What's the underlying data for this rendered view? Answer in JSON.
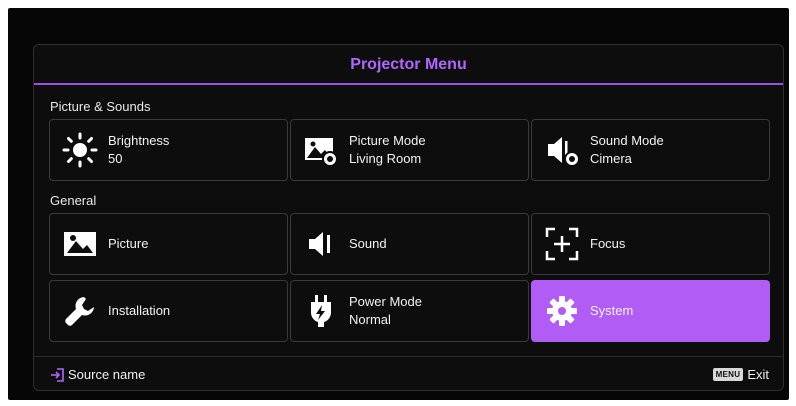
{
  "menu": {
    "title": "Projector Menu",
    "accent_color": "#b05cf5"
  },
  "sections": {
    "picture_sounds": {
      "label": "Picture & Sounds",
      "tiles": [
        {
          "name": "Brightness",
          "value": "50",
          "icon": "sun-icon"
        },
        {
          "name": "Picture Mode",
          "value": "Living Room",
          "icon": "picture-mode-icon"
        },
        {
          "name": "Sound Mode",
          "value": "Cimera",
          "icon": "sound-mode-icon"
        }
      ]
    },
    "general": {
      "label": "General",
      "tiles": [
        {
          "name": "Picture",
          "icon": "picture-icon"
        },
        {
          "name": "Sound",
          "icon": "speaker-icon"
        },
        {
          "name": "Focus",
          "icon": "focus-icon"
        },
        {
          "name": "Installation",
          "icon": "wrench-icon"
        },
        {
          "name": "Power Mode",
          "value": "Normal",
          "icon": "power-plug-icon"
        },
        {
          "name": "System",
          "icon": "gear-icon",
          "selected": true
        }
      ]
    }
  },
  "footer": {
    "source_label": "Source name",
    "menu_key": "MENU",
    "exit_label": "Exit"
  }
}
